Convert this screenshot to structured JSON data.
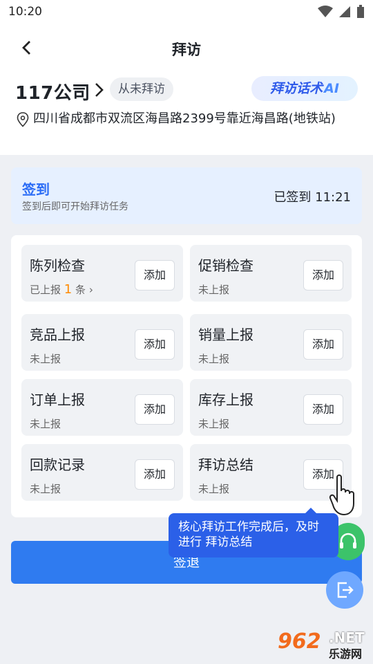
{
  "status_bar": {
    "time": "10:20"
  },
  "nav": {
    "title": "拜访"
  },
  "store": {
    "name": "117公司",
    "visit_status": "从未拜访",
    "ai_button": {
      "label": "拜访话术",
      "ai": "AI"
    },
    "address": "四川省成都市双流区海昌路2399号靠近海昌路(地铁站)"
  },
  "signin": {
    "title": "签到",
    "subtitle": "签到后即可开始拜访任务",
    "status": "已签到 11:21"
  },
  "tasks": [
    {
      "title": "陈列检查",
      "status_prefix": "已上报",
      "count": "1",
      "status_suffix": "条",
      "add": "添加"
    },
    {
      "title": "促销检查",
      "status": "未上报",
      "add": "添加"
    },
    {
      "title": "竞品上报",
      "status": "未上报",
      "add": "添加"
    },
    {
      "title": "销量上报",
      "status": "未上报",
      "add": "添加"
    },
    {
      "title": "订单上报",
      "status": "未上报",
      "add": "添加"
    },
    {
      "title": "库存上报",
      "status": "未上报",
      "add": "添加"
    },
    {
      "title": "回款记录",
      "status": "未上报",
      "add": "添加"
    },
    {
      "title": "拜访总结",
      "status": "未上报",
      "add": "添加"
    }
  ],
  "logout_label": "签退",
  "tooltip": "核心拜访工作完成后，及时进行 拜访总结",
  "watermark": {
    "logo": "962",
    "net": ".NET",
    "site": "乐游网"
  },
  "icons": {
    "back": "chevron-left-icon",
    "location": "location-pin-icon",
    "support": "headset-icon",
    "exit": "exit-icon",
    "pointer": "hand-pointer-icon"
  },
  "colors": {
    "accent": "#2f7bf0",
    "count": "#ff8a00",
    "tooltip": "#2b60e8"
  }
}
